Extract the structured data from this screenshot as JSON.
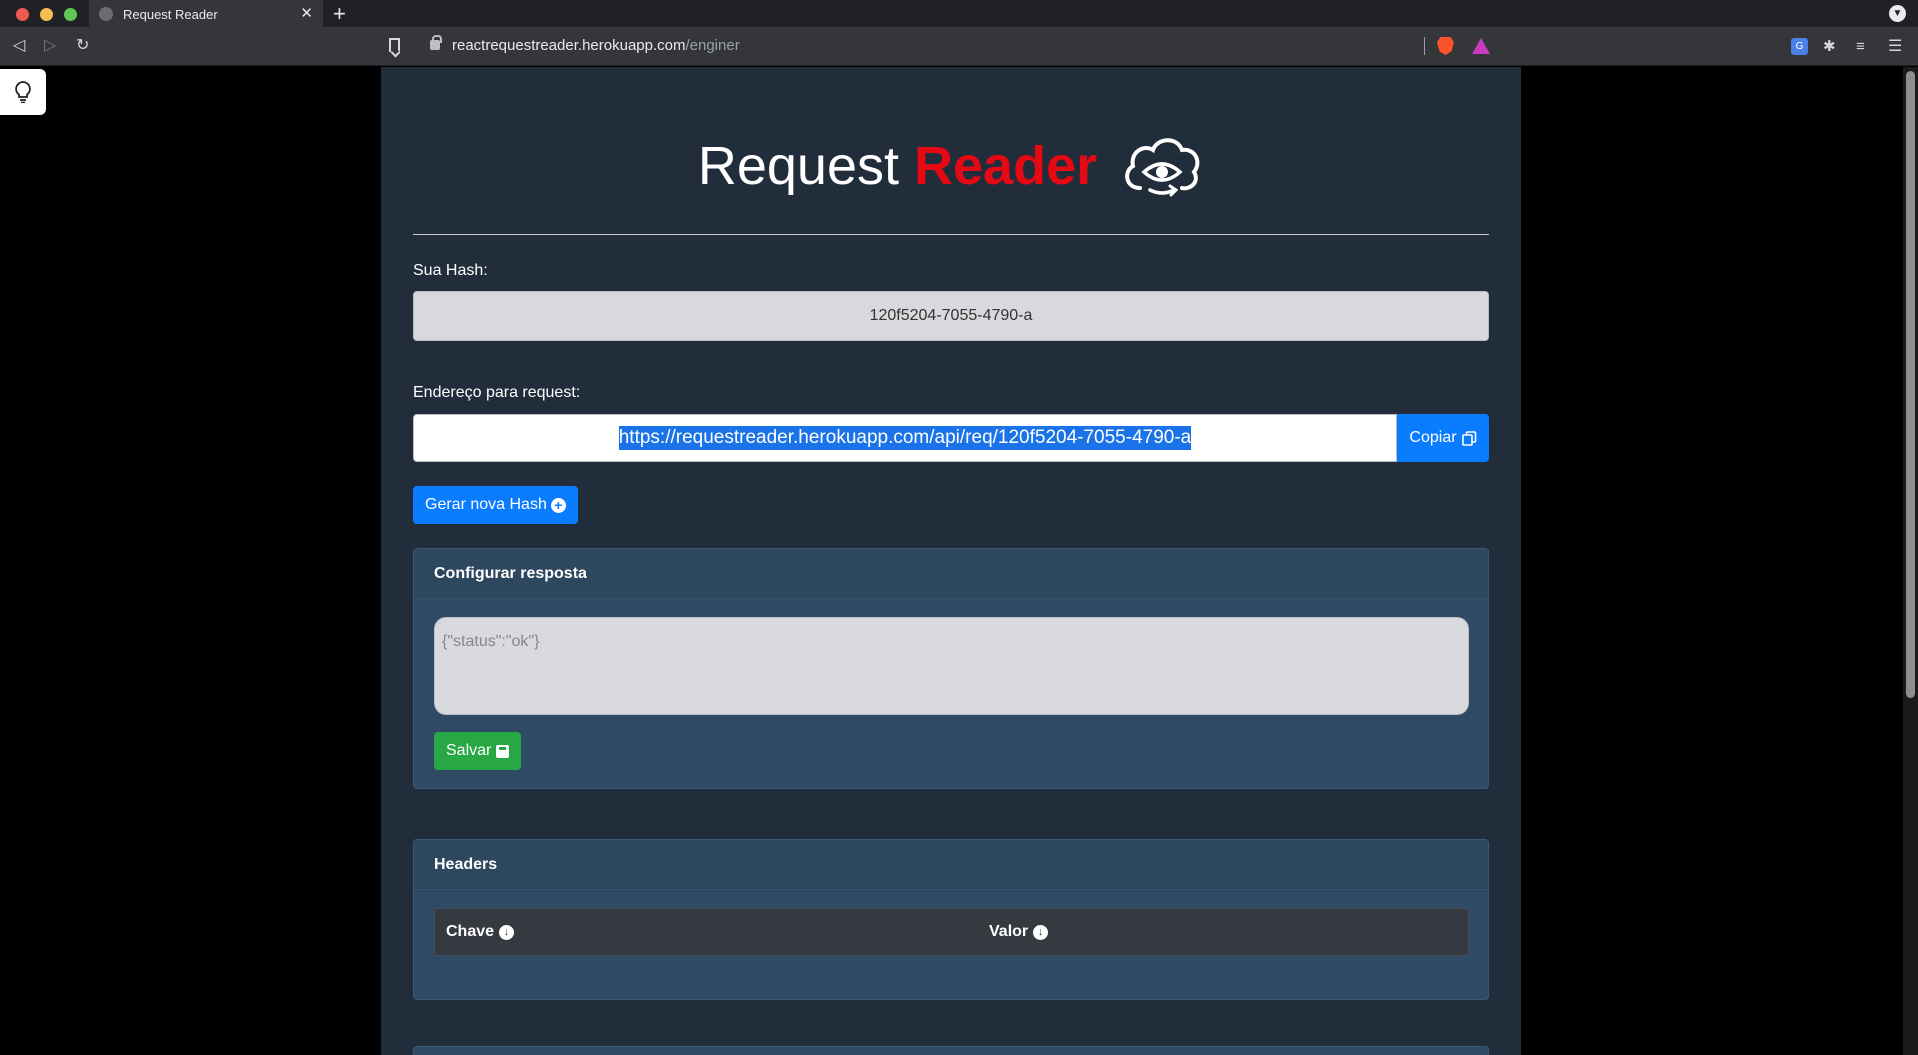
{
  "browser": {
    "tab_title": "Request Reader",
    "tab_close": "✕",
    "new_tab": "+",
    "url_host": "reactrequestreader.herokuapp.com",
    "url_path": "/enginer"
  },
  "header": {
    "title_plain": "Request ",
    "title_accent": "Reader",
    "accent_color": "#e50914"
  },
  "hash": {
    "label": "Sua Hash:",
    "value": "120f5204-7055-4790-a"
  },
  "request_url": {
    "label": "Endereço para request:",
    "value": "https://requestreader.herokuapp.com/api/req/120f5204-7055-4790-a",
    "copy_label": "Copiar"
  },
  "generate": {
    "label": "Gerar nova Hash"
  },
  "response_config": {
    "title": "Configurar resposta",
    "placeholder": "{\"status\":\"ok\"}",
    "save_label": "Salvar"
  },
  "headers": {
    "title": "Headers",
    "columns": [
      "Chave",
      "Valor"
    ]
  },
  "icons": {
    "hint": "lightbulb-icon",
    "logo": "cloud-eye-icon",
    "copy": "copy-icon",
    "add": "plus-circle-icon",
    "save": "save-icon",
    "sort": "arrow-down-circle-icon"
  }
}
